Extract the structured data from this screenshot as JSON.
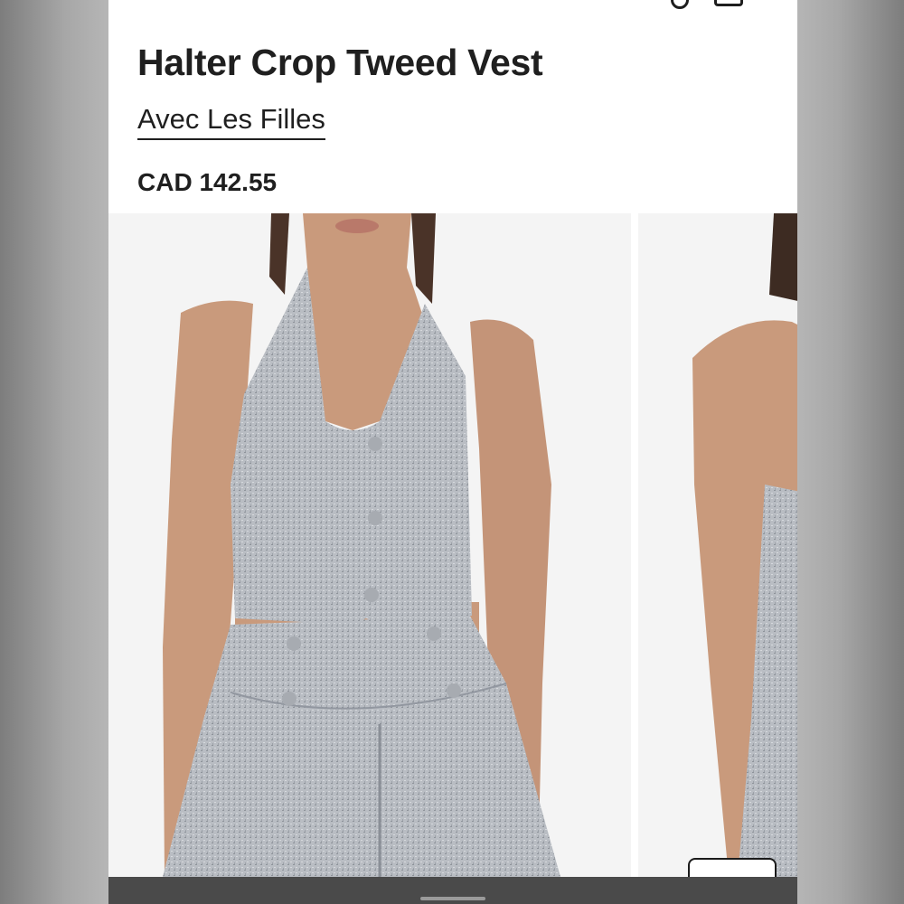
{
  "product": {
    "title": "Halter Crop Tweed Vest",
    "brand": "Avec Les Filles",
    "price": "CAD 142.55"
  },
  "header_icons": [
    "search-icon",
    "shopping-bag-icon"
  ],
  "gallery": {
    "images": [
      {
        "name": "front-view"
      },
      {
        "name": "back-view"
      }
    ]
  },
  "chat": {
    "icon": "chat-bubble-icon"
  },
  "colors": {
    "text": "#1f1f1f",
    "fabric": "#b8bcc2",
    "skin": "#c99a7c",
    "background": "#ffffff"
  }
}
